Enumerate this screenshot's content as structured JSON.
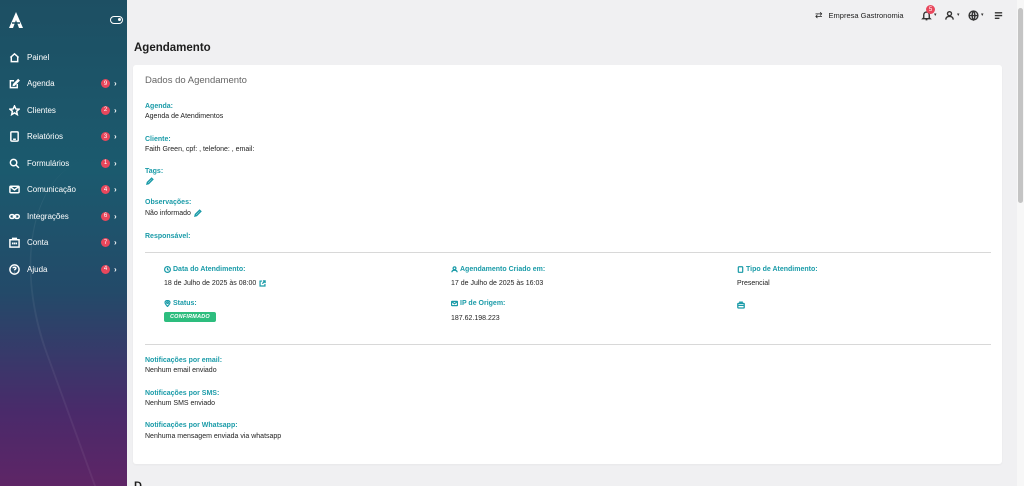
{
  "sidebar": {
    "items": [
      {
        "label": "Painel",
        "icon": "home-icon",
        "badge": ""
      },
      {
        "label": "Agenda",
        "icon": "edit-icon",
        "badge": "9"
      },
      {
        "label": "Clientes",
        "icon": "star-icon",
        "badge": "2"
      },
      {
        "label": "Relatórios",
        "icon": "tablet-icon",
        "badge": "3"
      },
      {
        "label": "Formulários",
        "icon": "search-icon",
        "badge": "1"
      },
      {
        "label": "Comunicação",
        "icon": "mail-icon",
        "badge": "4"
      },
      {
        "label": "Integrações",
        "icon": "link-icon",
        "badge": "6"
      },
      {
        "label": "Conta",
        "icon": "building-icon",
        "badge": "7"
      },
      {
        "label": "Ajuda",
        "icon": "help-icon",
        "badge": "4"
      }
    ]
  },
  "topbar": {
    "company": "Empresa Gastronomia",
    "notifications_count": "5"
  },
  "page": {
    "title": "Agendamento",
    "next_section_title": "D"
  },
  "card": {
    "title": "Dados do Agendamento",
    "agenda_label": "Agenda:",
    "agenda_value": "Agenda de Atendimentos",
    "cliente_label": "Cliente:",
    "cliente_value": "Faith Green, cpf: , telefone: , email:",
    "tags_label": "Tags:",
    "observacoes_label": "Observações:",
    "observacoes_value": "Não informado",
    "responsavel_label": "Responsável:",
    "data_label": "Data do Atendimento:",
    "data_value": "18 de Julho de 2025 às 08:00",
    "criado_label": "Agendamento Criado em:",
    "criado_value": "17 de Julho de 2025 às 16:03",
    "tipo_label": "Tipo de Atendimento:",
    "tipo_value": "Presencial",
    "status_label": "Status:",
    "status_value": "CONFIRMADO",
    "ip_label": "IP de Origem:",
    "ip_value": "187.62.198.223",
    "notif_email_label": "Notificações por email:",
    "notif_email_value": "Nenhum email enviado",
    "notif_sms_label": "Notificações por SMS:",
    "notif_sms_value": "Nenhum SMS enviado",
    "notif_whatsapp_label": "Notificações por Whatsapp:",
    "notif_whatsapp_value": "Nenhuma mensagem enviada via whatsapp"
  },
  "colors": {
    "accent": "#1a9ba8",
    "badge": "#e8475c",
    "status_confirmed": "#2dbd7e"
  }
}
